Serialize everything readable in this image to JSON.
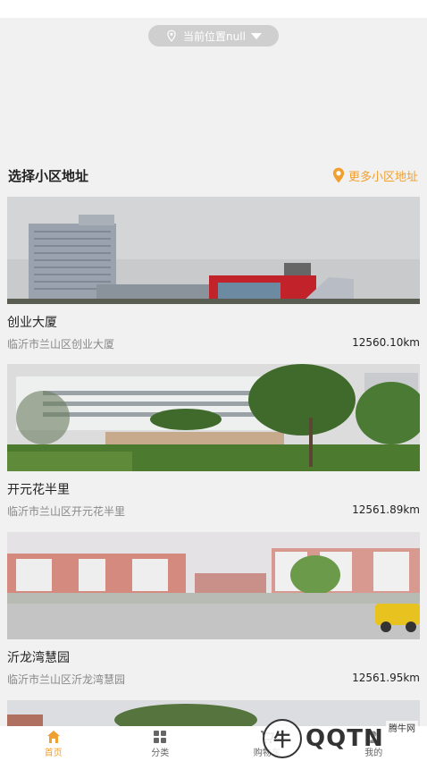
{
  "location": {
    "label": "当前位置null"
  },
  "section": {
    "title": "选择小区地址",
    "more_label": "更多小区地址"
  },
  "communities": [
    {
      "name": "创业大厦",
      "address": "临沂市兰山区创业大厦",
      "distance": "12560.10km"
    },
    {
      "name": "开元花半里",
      "address": "临沂市兰山区开元花半里",
      "distance": "12561.89km"
    },
    {
      "name": "沂龙湾慧园",
      "address": "临沂市兰山区沂龙湾慧园",
      "distance": "12561.95km"
    }
  ],
  "tabs": [
    {
      "label": "首页",
      "icon": "home-icon"
    },
    {
      "label": "分类",
      "icon": "grid-icon"
    },
    {
      "label": "购物车",
      "icon": "cart-icon"
    },
    {
      "label": "我的",
      "icon": "user-icon"
    }
  ],
  "watermark": {
    "brand": "QQTN",
    "sub": "腾牛网"
  },
  "colors": {
    "accent": "#f0a030",
    "background": "#f1f1f1"
  }
}
